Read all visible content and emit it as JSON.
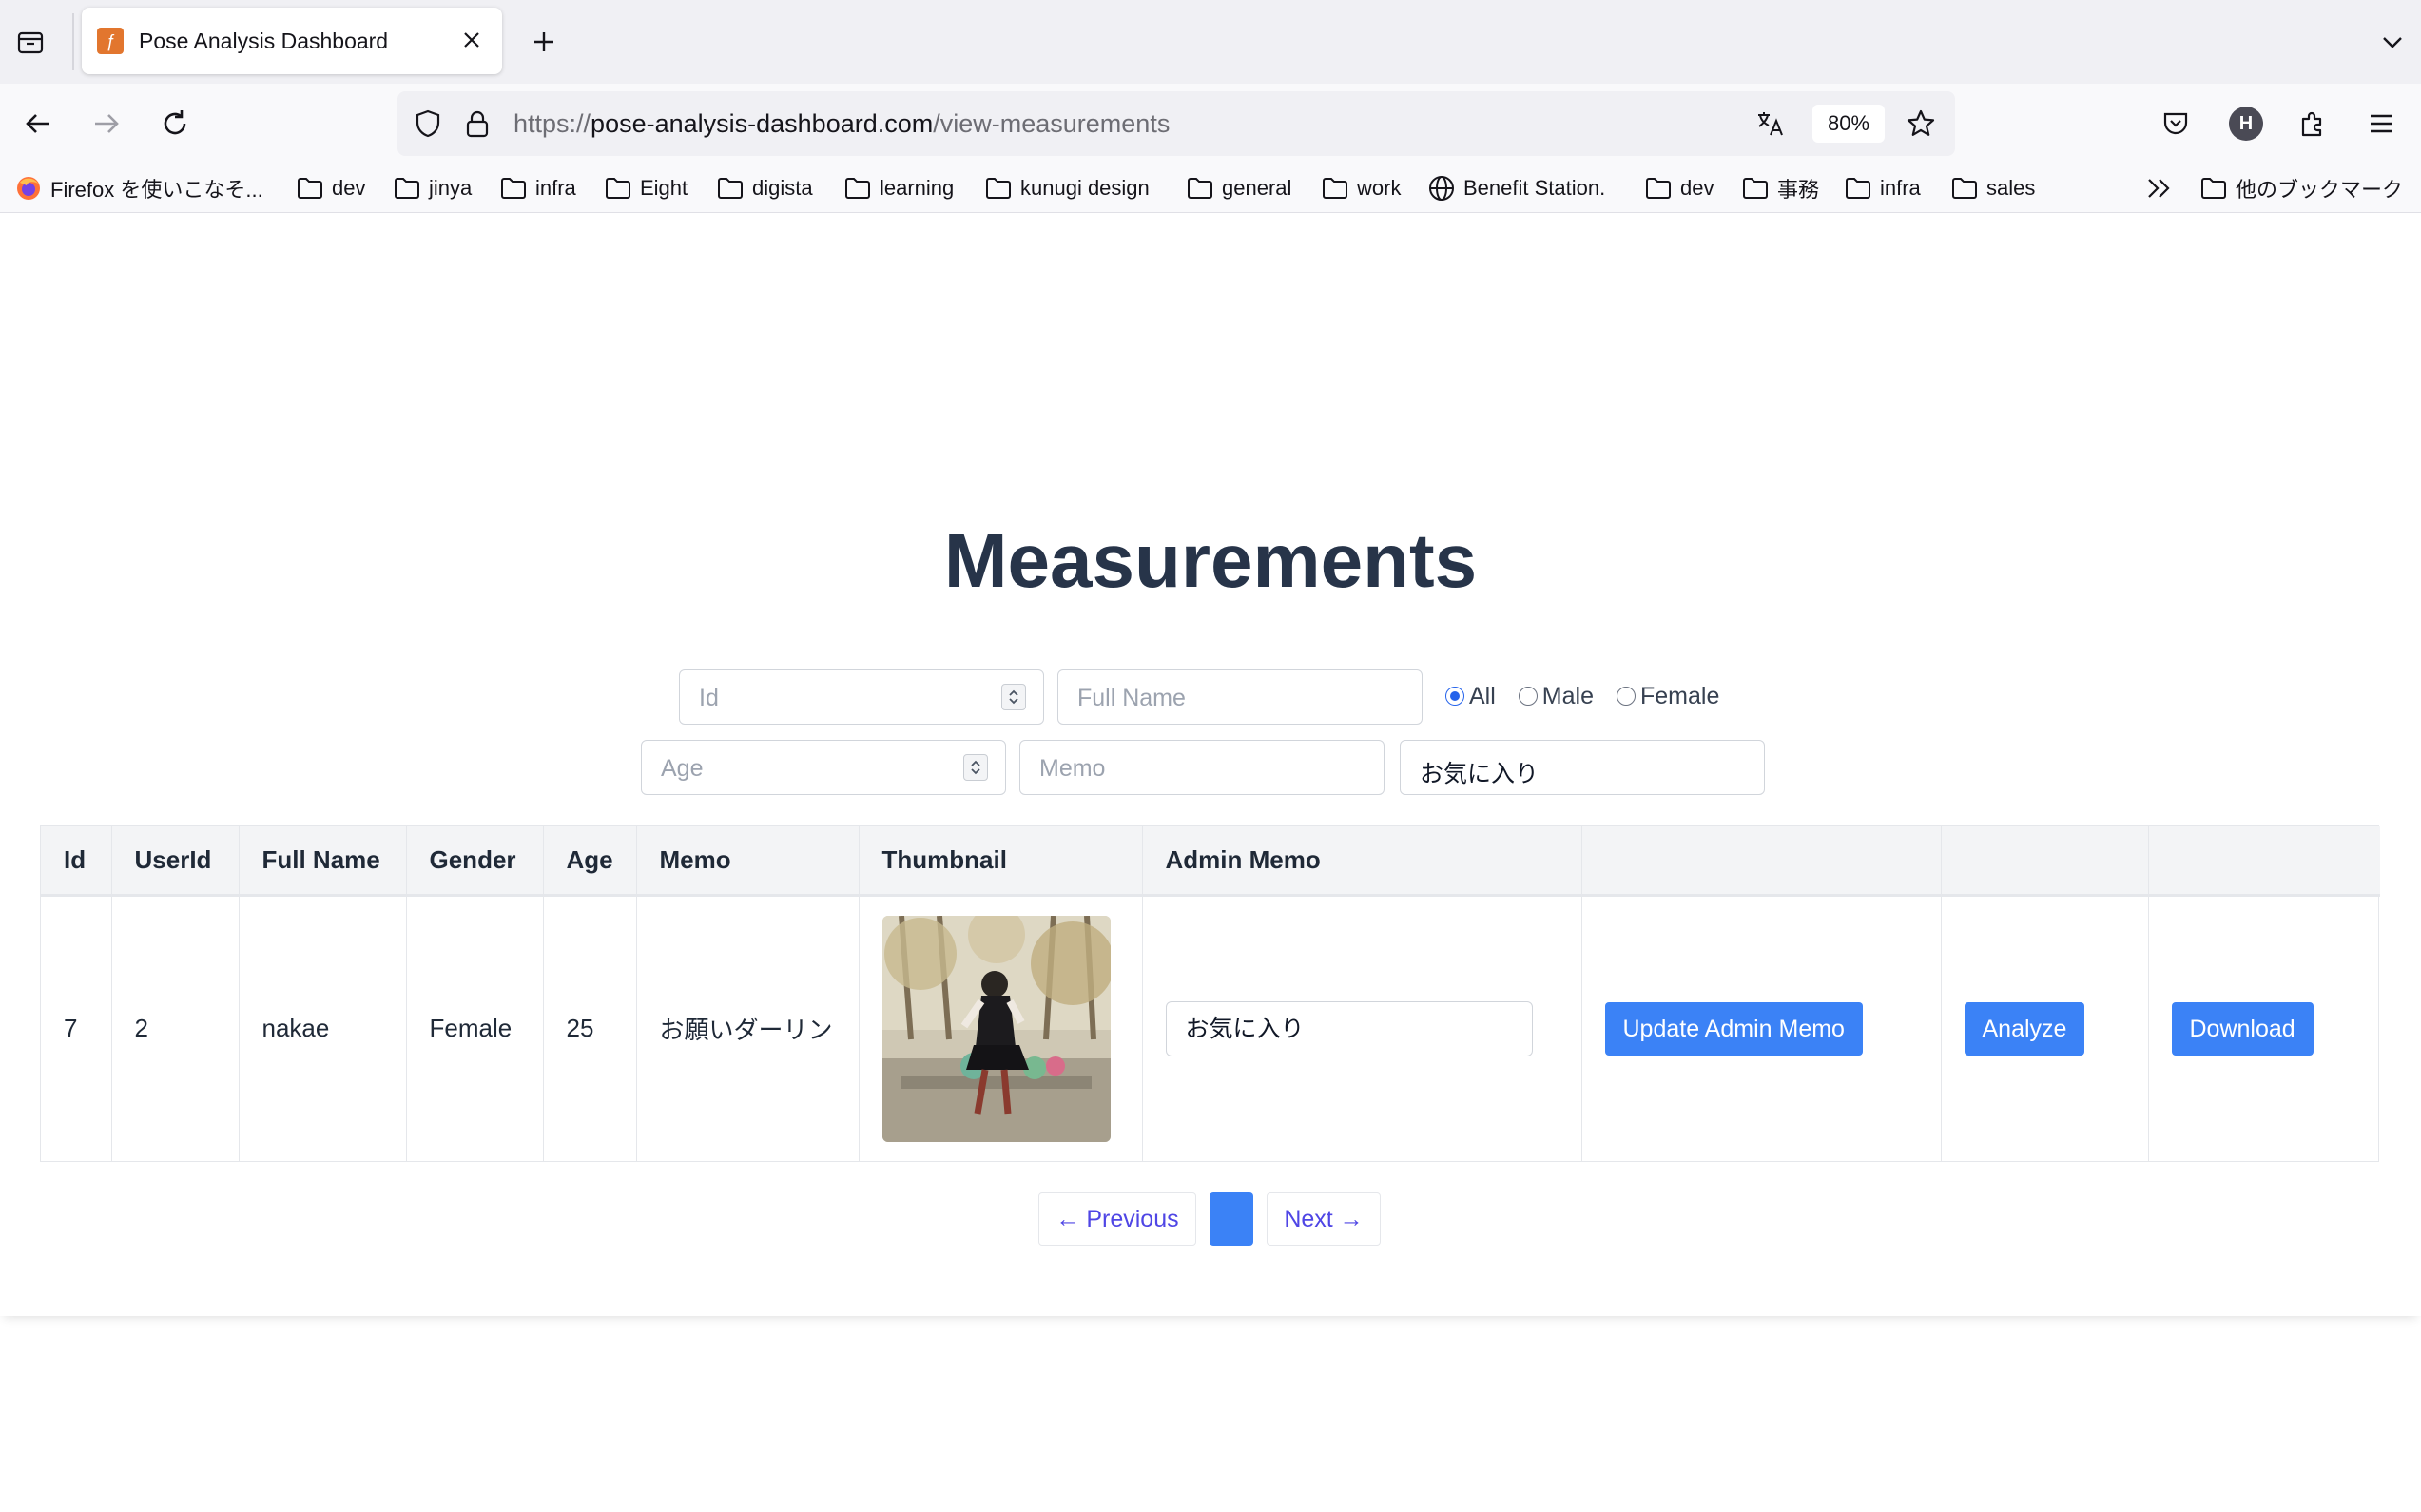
{
  "browser": {
    "tab": {
      "title": "Pose Analysis Dashboard"
    },
    "url": {
      "scheme": "https://",
      "host": "pose-analysis-dashboard.com",
      "path": "/view-measurements"
    },
    "zoom": "80%",
    "profile_initial": "H",
    "bookmarks": [
      {
        "label": "Firefox を使いこなそ...",
        "icon": "firefox-icon"
      },
      {
        "label": "dev",
        "icon": "folder-icon"
      },
      {
        "label": "jinya",
        "icon": "folder-icon"
      },
      {
        "label": "infra",
        "icon": "folder-icon"
      },
      {
        "label": "Eight",
        "icon": "folder-icon"
      },
      {
        "label": "digista",
        "icon": "folder-icon"
      },
      {
        "label": "learning",
        "icon": "folder-icon"
      },
      {
        "label": "kunugi design",
        "icon": "folder-icon"
      },
      {
        "label": "general",
        "icon": "folder-icon"
      },
      {
        "label": "work",
        "icon": "folder-icon"
      },
      {
        "label": "Benefit Station.",
        "icon": "globe-icon"
      },
      {
        "label": "dev",
        "icon": "folder-icon"
      },
      {
        "label": "事務",
        "icon": "folder-icon"
      },
      {
        "label": "infra",
        "icon": "folder-icon"
      },
      {
        "label": "sales",
        "icon": "folder-icon"
      }
    ],
    "other_bookmarks": "他のブックマーク"
  },
  "page": {
    "title": "Measurements",
    "filters": {
      "id_placeholder": "Id",
      "fullname_placeholder": "Full Name",
      "age_placeholder": "Age",
      "memo_placeholder": "Memo",
      "admin_memo_value": "お気に入り",
      "gender_options": [
        "All",
        "Male",
        "Female"
      ],
      "gender_selected": "All"
    },
    "table": {
      "columns": [
        "Id",
        "UserId",
        "Full Name",
        "Gender",
        "Age",
        "Memo",
        "Thumbnail",
        "Admin Memo",
        "",
        "",
        ""
      ],
      "rows": [
        {
          "id": "7",
          "user_id": "2",
          "full_name": "nakae",
          "gender": "Female",
          "age": "25",
          "memo": "お願いダーリン",
          "admin_memo": "お気に入り",
          "update_label": "Update Admin Memo",
          "analyze_label": "Analyze",
          "download_label": "Download"
        }
      ]
    },
    "pagination": {
      "previous": "← Previous",
      "next": "Next →"
    }
  },
  "colors": {
    "primary": "#3b82f6",
    "title": "#273449",
    "link": "#4f46e5"
  }
}
